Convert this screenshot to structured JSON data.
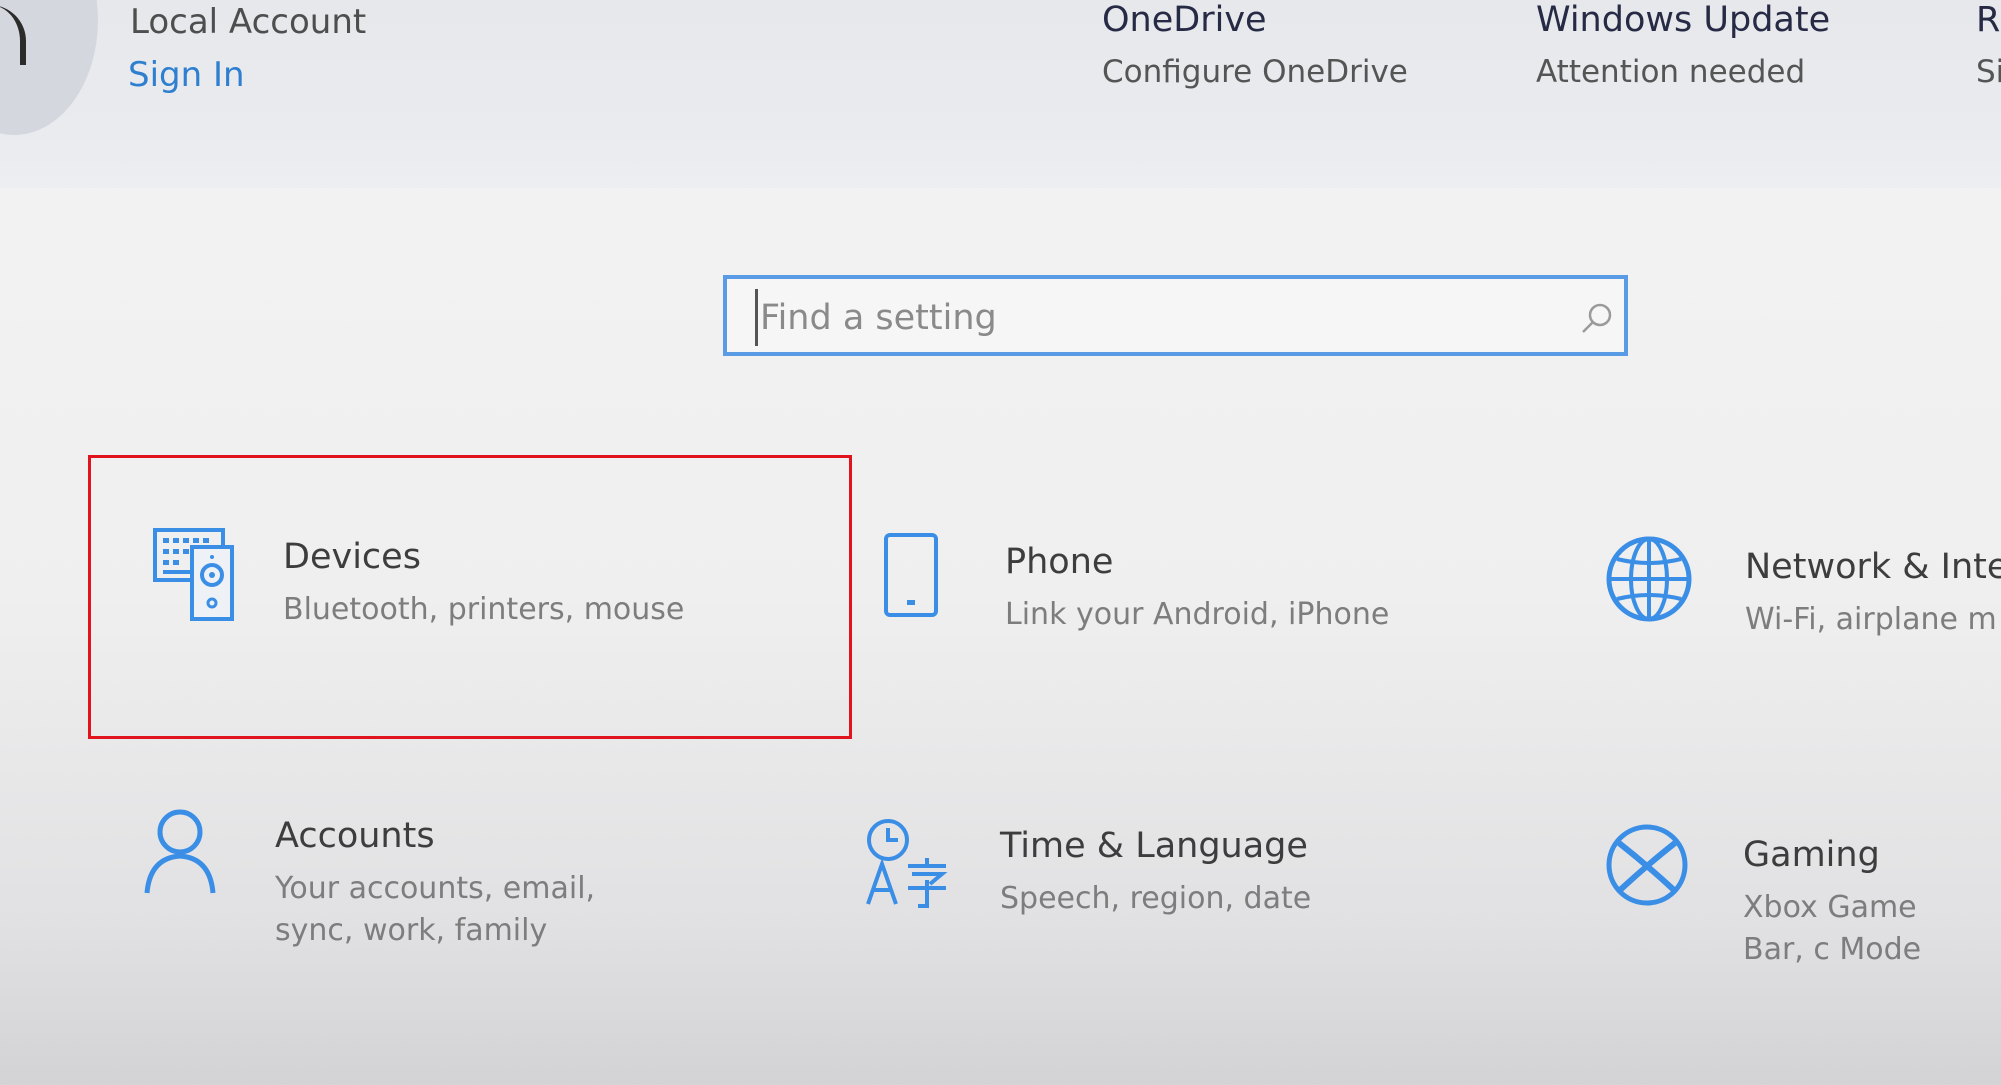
{
  "header": {
    "account_name": "Local Account",
    "sign_in_label": "Sign In",
    "onedrive": {
      "title": "OneDrive",
      "subtitle": "Configure OneDrive"
    },
    "windows_update": {
      "title": "Windows Update",
      "subtitle": "Attention needed"
    },
    "rewards": {
      "title": "R",
      "subtitle": "Si"
    }
  },
  "search": {
    "placeholder": "Find a setting",
    "value": ""
  },
  "tiles": [
    {
      "title": "Devices",
      "desc": "Bluetooth, printers, mouse",
      "icon": "devices-icon"
    },
    {
      "title": "Phone",
      "desc": "Link your Android, iPhone",
      "icon": "phone-icon"
    },
    {
      "title": "Network & Inte",
      "desc": "Wi-Fi, airplane m",
      "icon": "globe-icon"
    },
    {
      "title": "Accounts",
      "desc": "Your accounts, email, sync, work, family",
      "icon": "person-icon"
    },
    {
      "title": "Time & Language",
      "desc": "Speech, region, date",
      "icon": "time-language-icon"
    },
    {
      "title": "Gaming",
      "desc": "Xbox Game Bar, c Mode",
      "icon": "xbox-icon"
    }
  ],
  "colors": {
    "accent": "#2f7fd0",
    "icon_blue": "#3a8ee6",
    "highlight": "#e1141e",
    "search_border": "#5a9be6"
  }
}
